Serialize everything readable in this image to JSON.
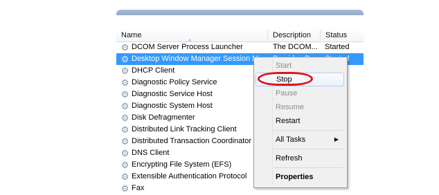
{
  "columns": {
    "name": "Name",
    "description": "Description",
    "status": "Status"
  },
  "sort_indicator": "^",
  "services": [
    {
      "name": "DCOM Server Process Launcher",
      "description": "The DCOM...",
      "status": "Started"
    },
    {
      "name": "Desktop Window Manager Session Ma...",
      "description": "Provides De...",
      "status": "Started"
    },
    {
      "name": "DHCP Client",
      "description": "",
      "status": ""
    },
    {
      "name": "Diagnostic Policy Service",
      "description": "",
      "status": ""
    },
    {
      "name": "Diagnostic Service Host",
      "description": "",
      "status": ""
    },
    {
      "name": "Diagnostic System Host",
      "description": "",
      "status": ""
    },
    {
      "name": "Disk Defragmenter",
      "description": "",
      "status": ""
    },
    {
      "name": "Distributed Link Tracking Client",
      "description": "",
      "status": ""
    },
    {
      "name": "Distributed Transaction Coordinator",
      "description": "",
      "status": ""
    },
    {
      "name": "DNS Client",
      "description": "",
      "status": ""
    },
    {
      "name": "Encrypting File System (EFS)",
      "description": "",
      "status": ""
    },
    {
      "name": "Extensible Authentication Protocol",
      "description": "",
      "status": ""
    },
    {
      "name": "Fax",
      "description": "",
      "status": ""
    }
  ],
  "context_menu": {
    "start": "Start",
    "stop": "Stop",
    "pause": "Pause",
    "resume": "Resume",
    "restart": "Restart",
    "all_tasks": "All Tasks",
    "refresh": "Refresh",
    "properties": "Properties"
  },
  "colors": {
    "selection": "#3399ff",
    "annotation": "#e0151b"
  },
  "icons": {
    "service": "gear-icon",
    "submenu": "chevron-right-icon"
  }
}
